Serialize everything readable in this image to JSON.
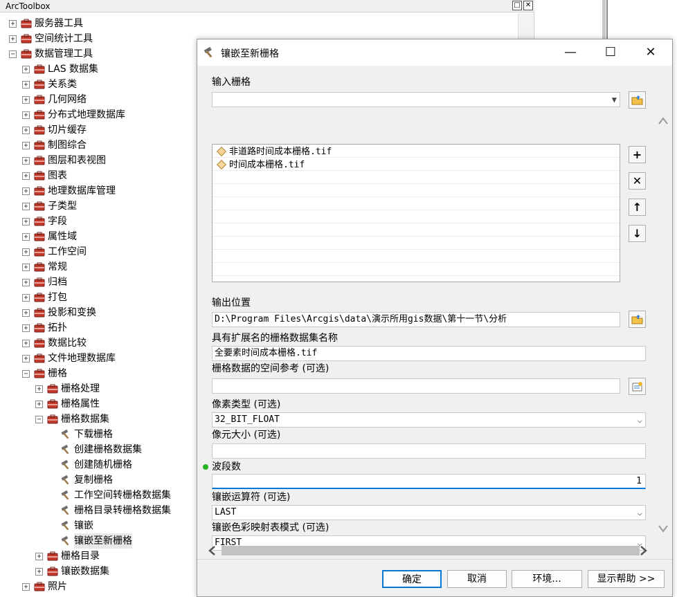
{
  "toolbox": {
    "title": "ArcToolbox",
    "items": [
      {
        "label": "服务器工具",
        "level": 0,
        "expander": "+",
        "icon": "toolbox"
      },
      {
        "label": "空间统计工具",
        "level": 0,
        "expander": "+",
        "icon": "toolbox"
      },
      {
        "label": "数据管理工具",
        "level": 0,
        "expander": "−",
        "icon": "toolbox"
      },
      {
        "label": "LAS 数据集",
        "level": 1,
        "expander": "+",
        "icon": "toolset"
      },
      {
        "label": "关系类",
        "level": 1,
        "expander": "+",
        "icon": "toolset"
      },
      {
        "label": "几何网络",
        "level": 1,
        "expander": "+",
        "icon": "toolset"
      },
      {
        "label": "分布式地理数据库",
        "level": 1,
        "expander": "+",
        "icon": "toolset"
      },
      {
        "label": "切片缓存",
        "level": 1,
        "expander": "+",
        "icon": "toolset"
      },
      {
        "label": "制图综合",
        "level": 1,
        "expander": "+",
        "icon": "toolset"
      },
      {
        "label": "图层和表视图",
        "level": 1,
        "expander": "+",
        "icon": "toolset"
      },
      {
        "label": "图表",
        "level": 1,
        "expander": "+",
        "icon": "toolset"
      },
      {
        "label": "地理数据库管理",
        "level": 1,
        "expander": "+",
        "icon": "toolset"
      },
      {
        "label": "子类型",
        "level": 1,
        "expander": "+",
        "icon": "toolset"
      },
      {
        "label": "字段",
        "level": 1,
        "expander": "+",
        "icon": "toolset"
      },
      {
        "label": "属性域",
        "level": 1,
        "expander": "+",
        "icon": "toolset"
      },
      {
        "label": "工作空间",
        "level": 1,
        "expander": "+",
        "icon": "toolset"
      },
      {
        "label": "常规",
        "level": 1,
        "expander": "+",
        "icon": "toolset"
      },
      {
        "label": "归档",
        "level": 1,
        "expander": "+",
        "icon": "toolset"
      },
      {
        "label": "打包",
        "level": 1,
        "expander": "+",
        "icon": "toolset"
      },
      {
        "label": "投影和变换",
        "level": 1,
        "expander": "+",
        "icon": "toolset"
      },
      {
        "label": "拓扑",
        "level": 1,
        "expander": "+",
        "icon": "toolset"
      },
      {
        "label": "数据比较",
        "level": 1,
        "expander": "+",
        "icon": "toolset"
      },
      {
        "label": "文件地理数据库",
        "level": 1,
        "expander": "+",
        "icon": "toolset"
      },
      {
        "label": "栅格",
        "level": 1,
        "expander": "−",
        "icon": "toolset"
      },
      {
        "label": "栅格处理",
        "level": 2,
        "expander": "+",
        "icon": "toolset"
      },
      {
        "label": "栅格属性",
        "level": 2,
        "expander": "+",
        "icon": "toolset"
      },
      {
        "label": "栅格数据集",
        "level": 2,
        "expander": "−",
        "icon": "toolset"
      },
      {
        "label": "下载栅格",
        "level": 3,
        "expander": "",
        "icon": "hammer"
      },
      {
        "label": "创建栅格数据集",
        "level": 3,
        "expander": "",
        "icon": "hammer"
      },
      {
        "label": "创建随机栅格",
        "level": 3,
        "expander": "",
        "icon": "hammer"
      },
      {
        "label": "复制栅格",
        "level": 3,
        "expander": "",
        "icon": "hammer"
      },
      {
        "label": "工作空间转栅格数据集",
        "level": 3,
        "expander": "",
        "icon": "hammer"
      },
      {
        "label": "栅格目录转栅格数据集",
        "level": 3,
        "expander": "",
        "icon": "hammer"
      },
      {
        "label": "镶嵌",
        "level": 3,
        "expander": "",
        "icon": "hammer"
      },
      {
        "label": "镶嵌至新栅格",
        "level": 3,
        "expander": "",
        "icon": "hammer"
      },
      {
        "label": "栅格目录",
        "level": 2,
        "expander": "+",
        "icon": "toolset"
      },
      {
        "label": "镶嵌数据集",
        "level": 2,
        "expander": "+",
        "icon": "toolset"
      },
      {
        "label": "照片",
        "level": 1,
        "expander": "+",
        "icon": "toolset"
      }
    ]
  },
  "dialog": {
    "title": "镶嵌至新栅格",
    "input_label": "输入栅格",
    "input_value": "",
    "rasters": [
      "非道路时间成本栅格.tif",
      "时间成本栅格.tif"
    ],
    "output_location_label": "输出位置",
    "output_location_value": "D:\\Program Files\\Arcgis\\data\\演示所用gis数据\\第十一节\\分析",
    "dataset_name_label": "具有扩展名的栅格数据集名称",
    "dataset_name_value": "全要素时间成本栅格.tif",
    "spatial_ref_label": "栅格数据的空间参考 (可选)",
    "spatial_ref_value": "",
    "pixel_type_label": "像素类型 (可选)",
    "pixel_type_value": "32_BIT_FLOAT",
    "cell_size_label": "像元大小 (可选)",
    "cell_size_value": "",
    "bands_label": "波段数",
    "bands_value": "1",
    "mosaic_op_label": "镶嵌运算符 (可选)",
    "mosaic_op_value": "LAST",
    "colormap_label": "镶嵌色彩映射表模式 (可选)",
    "colormap_value": "FIRST",
    "buttons": {
      "ok": "确定",
      "cancel": "取消",
      "env": "环境...",
      "help": "显示帮助 >>"
    }
  },
  "colors": {
    "accent": "#0078d7",
    "required": "#26b326"
  }
}
